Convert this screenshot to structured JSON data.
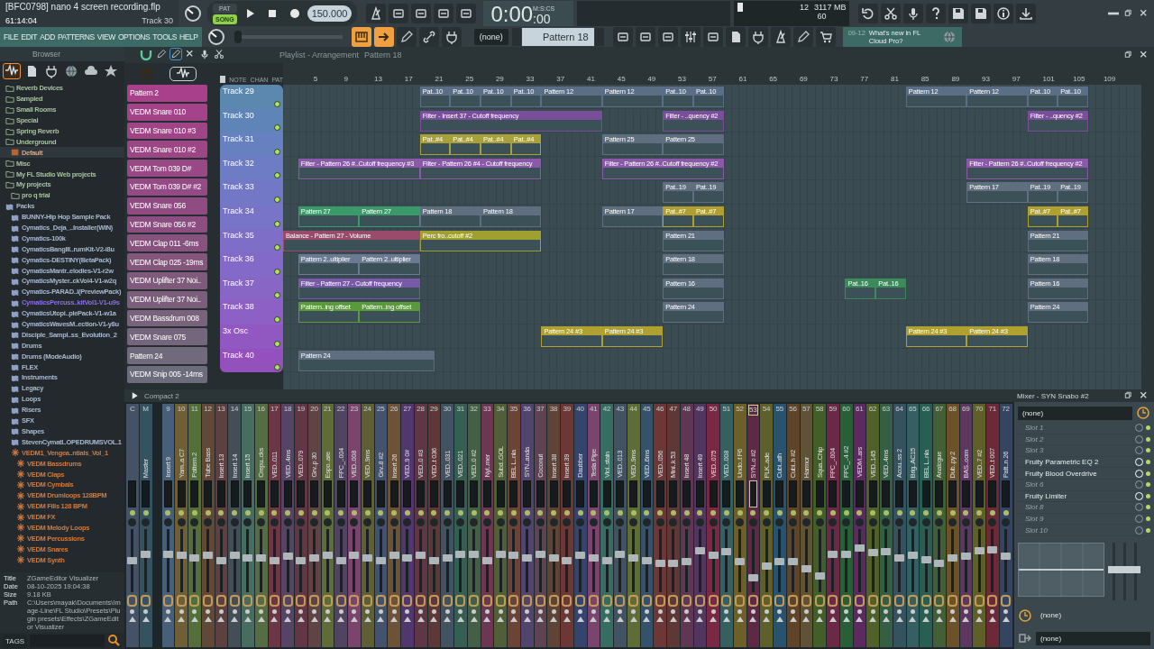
{
  "title_panel": {
    "project": "[BFC0798] nano 4 screen recording.flp",
    "position": "61:14:04",
    "track": "Track 30"
  },
  "transport": {
    "pat": "PAT",
    "song": "SONG",
    "song_mode": true,
    "tempo": "150.000",
    "time": "0:00",
    "time_cs": ":00",
    "time_unit": "M:S:CS"
  },
  "monitor": {
    "cpu": "12",
    "memory": "3117 MB",
    "polyphony": "60"
  },
  "menu": [
    "FILE",
    "EDIT",
    "ADD",
    "PATTERNS",
    "VIEW",
    "OPTIONS",
    "TOOLS",
    "HELP"
  ],
  "master_pitch": {
    "level": 0
  },
  "snap": "(none)",
  "pattern": "Pattern 18",
  "news": {
    "date": "09-12",
    "text": "What's new in FL Cloud Pro?"
  },
  "browser": {
    "title": "Browser",
    "tree": [
      {
        "label": "Reverb Devices",
        "kind": "folder",
        "selected": false
      },
      {
        "label": "Sampled",
        "kind": "folder",
        "selected": false
      },
      {
        "label": "Small Rooms",
        "kind": "folder",
        "selected": false
      },
      {
        "label": "Special",
        "kind": "folder",
        "selected": false
      },
      {
        "label": "Spring Reverb",
        "kind": "folder",
        "selected": false
      },
      {
        "label": "Underground",
        "kind": "folder",
        "selected": false,
        "children": [
          {
            "label": "Default",
            "kind": "preset",
            "selected": false
          }
        ]
      },
      {
        "label": "Misc",
        "kind": "folder",
        "selected": false
      },
      {
        "label": "My FL Studio Web projects",
        "kind": "folder",
        "selected": false
      },
      {
        "label": "My projects",
        "kind": "folder",
        "selected": false,
        "children": [
          {
            "label": "pro q trial",
            "kind": "folder",
            "selected": false
          }
        ]
      },
      {
        "label": "Packs",
        "kind": "pack",
        "selected": false,
        "children": [
          {
            "label": "BUNNY-Hip Hop Sample Pack",
            "kind": "pack",
            "selected": false
          },
          {
            "label": "Cymatics_Deja_..Installer(WIN)",
            "kind": "pack",
            "selected": false
          },
          {
            "label": "Cymatics-100k",
            "kind": "pack",
            "selected": false
          },
          {
            "label": "CymaticsBangIII..rumKit-V2-i8u",
            "kind": "pack",
            "selected": false
          },
          {
            "label": "Cymatics-DESTINY(BetaPack)",
            "kind": "pack",
            "selected": false
          },
          {
            "label": "CymaticsMantr..elodies-V1-r2w",
            "kind": "pack",
            "selected": false
          },
          {
            "label": "CymaticsMyster..ckVol4-V1-w2q",
            "kind": "pack",
            "selected": false
          },
          {
            "label": "Cymatics-PARAD..I(PreviewPack)",
            "kind": "pack",
            "selected": false
          },
          {
            "label": "CymaticsPercuss..kitVol1-V1-u9s",
            "kind": "pack",
            "selected": true
          },
          {
            "label": "CymaticsUtopi..plePack-V1-w1a",
            "kind": "pack",
            "selected": false
          },
          {
            "label": "CymaticsWavesM..ection-V1-y8u",
            "kind": "pack",
            "selected": false
          },
          {
            "label": "Disciple_Sampl..ss_Evolution_2",
            "kind": "pack",
            "selected": false
          },
          {
            "label": "Drums",
            "kind": "pack",
            "selected": false
          },
          {
            "label": "Drums (ModeAudio)",
            "kind": "pack",
            "selected": false
          },
          {
            "label": "FLEX",
            "kind": "pack",
            "selected": false
          },
          {
            "label": "Instruments",
            "kind": "pack",
            "selected": false
          },
          {
            "label": "Legacy",
            "kind": "pack",
            "selected": false
          },
          {
            "label": "Loops",
            "kind": "pack",
            "selected": false
          },
          {
            "label": "Risers",
            "kind": "pack",
            "selected": false
          },
          {
            "label": "SFX",
            "kind": "pack",
            "selected": false
          },
          {
            "label": "Shapes",
            "kind": "pack",
            "selected": false
          },
          {
            "label": "StevenCymatI..OPEDRUMSVOL.1",
            "kind": "pack",
            "selected": false
          },
          {
            "label": "VEDM1_Vengea..ntials_Vol_1",
            "kind": "kit",
            "selected": false,
            "children": [
              {
                "label": "VEDM Bassdrums",
                "kind": "kit",
                "selected": false
              },
              {
                "label": "VEDM Claps",
                "kind": "kit",
                "selected": false
              },
              {
                "label": "VEDM Cymbals",
                "kind": "kit",
                "selected": false
              },
              {
                "label": "VEDM Drumloops 128BPM",
                "kind": "kit",
                "selected": false
              },
              {
                "label": "VEDM Fills 128 BPM",
                "kind": "kit",
                "selected": false
              },
              {
                "label": "VEDM FX",
                "kind": "kit",
                "selected": false
              },
              {
                "label": "VEDM Melody Loops",
                "kind": "kit",
                "selected": false
              },
              {
                "label": "VEDM Percussions",
                "kind": "kit",
                "selected": false
              },
              {
                "label": "VEDM Snares",
                "kind": "kit",
                "selected": false
              },
              {
                "label": "VEDM Synth",
                "kind": "kit",
                "selected": false
              }
            ]
          }
        ]
      }
    ],
    "info": [
      {
        "key": "Title",
        "value": "ZGameEditor Visualizer"
      },
      {
        "key": "Date",
        "value": "08-10-2025 19:04:38"
      },
      {
        "key": "Size",
        "value": "9.18 KB"
      },
      {
        "key": "Path",
        "value": "C:\\Users\\mayak\\Documents\\Image-Line\\FL Studio\\Presets\\Plugin presets\\Effects\\ZGameEditor Visualizer"
      }
    ],
    "tags": "TAGS"
  },
  "playlist": {
    "title": "Playlist - Arrangement",
    "pattern": "Pattern 18",
    "view_buttons": [
      "NOTE",
      "CHAN",
      "PAT"
    ],
    "ruler": [
      "5",
      "9",
      "13",
      "17",
      "21",
      "25",
      "29",
      "33",
      "37",
      "41",
      "45",
      "49",
      "53",
      "57",
      "61",
      "65",
      "69",
      "73",
      "77",
      "81",
      "85",
      "89",
      "93",
      "97",
      "101",
      "105",
      "109"
    ],
    "channels": [
      {
        "name": "Pattern 2",
        "color": "#a8408c"
      },
      {
        "name": "VEDM Snare 010",
        "color": "#a4428a"
      },
      {
        "name": "VEDM Snare 010 #3",
        "color": "#a04488"
      },
      {
        "name": "VEDM Snare 010 #2",
        "color": "#9c4686"
      },
      {
        "name": "VEDM Tom 039 D#",
        "color": "#984884"
      },
      {
        "name": "VEDM Tom 039 D# #2",
        "color": "#944a84"
      },
      {
        "name": "VEDM Snare 056",
        "color": "#904c82"
      },
      {
        "name": "VEDM Snare 056 #2",
        "color": "#8c4e80"
      },
      {
        "name": "VEDM Clap 011 -6ms",
        "color": "#88527e"
      },
      {
        "name": "VEDM Clap 025 -19ms",
        "color": "#84567c"
      },
      {
        "name": "VEDM Uplifter 37 Noi..",
        "color": "#805a7c"
      },
      {
        "name": "VEDM Uplifter 37 Noi..",
        "color": "#7c5e7c"
      },
      {
        "name": "VEDM Bassdrum 008",
        "color": "#78627c"
      },
      {
        "name": "VEDM Snare 075",
        "color": "#74667c"
      },
      {
        "name": "Pattern 24",
        "color": "#706a7c"
      },
      {
        "name": "VEDM Snip 005 -14ms",
        "color": "#6c6c7c"
      }
    ],
    "tracks": [
      {
        "name": "Track 29",
        "color": "#5c88b0",
        "clips": [
          {
            "label": "Pat..10",
            "color": "#5a6f86"
          },
          {
            "label": "Pat..10",
            "color": "#5a6f86"
          },
          {
            "label": "Pat..10",
            "color": "#5a6f86"
          },
          {
            "label": "Pat..10",
            "color": "#5a6f86"
          },
          {
            "label": "Pattern 12",
            "color": "#5a6f86"
          },
          {
            "label": "Pattern 12",
            "color": "#5a6f86"
          },
          {
            "label": "Pat..10",
            "color": "#5a6f86"
          },
          {
            "label": "Pat..10",
            "color": "#5a6f86"
          },
          {
            "label": "Pattern 12",
            "color": "#5a6f86"
          },
          {
            "label": "Pattern 12",
            "color": "#5a6f86"
          },
          {
            "label": "Pat..10",
            "color": "#5a6f86"
          },
          {
            "label": "Pat..10",
            "color": "#5a6f86"
          }
        ]
      },
      {
        "name": "Track 30",
        "color": "#5f85b8",
        "clips": [
          {
            "label": "Filter - Insert 37 - Cutoff frequency",
            "color": "#7a4f9a"
          },
          {
            "label": "Filter - ..quency #2",
            "color": "#7a4f9a"
          },
          {
            "label": "Filter - ..quency #2",
            "color": "#7a4f9a"
          }
        ]
      },
      {
        "name": "Track 31",
        "color": "#6680c0",
        "clips": [
          {
            "label": "Pat..#4",
            "color": "#a8a03a"
          },
          {
            "label": "Pat..#4",
            "color": "#a8a03a"
          },
          {
            "label": "Pat..#4",
            "color": "#a8a03a"
          },
          {
            "label": "Pat..#4",
            "color": "#a8a03a"
          },
          {
            "label": "Pattern 25",
            "color": "#5f6f80"
          },
          {
            "label": "Pattern 25",
            "color": "#5f6f80"
          }
        ]
      },
      {
        "name": "Track 32",
        "color": "#6d7cc4",
        "clips": [
          {
            "label": "Filter - Pattern 26 #..Cutoff frequency #3",
            "color": "#8a5aa8"
          },
          {
            "label": "Filter - Pattern 26 #4 - Cutoff frequency",
            "color": "#8a5aa8"
          },
          {
            "label": "Filter - Pattern 26 #..Cutoff frequency #2",
            "color": "#8a5aa8"
          },
          {
            "label": "Filter - Pattern 26 #..Cutoff frequency #2",
            "color": "#8a5aa8"
          }
        ]
      },
      {
        "name": "Track 33",
        "color": "#7278c6",
        "clips": [
          {
            "label": "Pat..19",
            "color": "#5f6f80"
          },
          {
            "label": "Pat..19",
            "color": "#5f6f80"
          },
          {
            "label": "Pattern 17",
            "color": "#5f6f80"
          },
          {
            "label": "Pat..19",
            "color": "#5f6f80"
          },
          {
            "label": "Pat..19",
            "color": "#5f6f80"
          }
        ]
      },
      {
        "name": "Track 34",
        "color": "#7874c8",
        "clips": [
          {
            "label": "Pattern 27",
            "color": "#3a9a6a"
          },
          {
            "label": "Pattern 27",
            "color": "#3a9a6a"
          },
          {
            "label": "Pattern 18",
            "color": "#5f6f80"
          },
          {
            "label": "Pattern 18",
            "color": "#5f6f80"
          },
          {
            "label": "Pattern 17",
            "color": "#5f6f80"
          },
          {
            "label": "Pat..#7",
            "color": "#b0a030"
          },
          {
            "label": "Pat..#7",
            "color": "#b0a030"
          },
          {
            "label": "Pat..#7",
            "color": "#b0a030"
          },
          {
            "label": "Pat..#7",
            "color": "#b0a030"
          }
        ]
      },
      {
        "name": "Track 35",
        "color": "#7e6ec8",
        "clips": [
          {
            "label": "Balance - Pattern 27 - Volume",
            "color": "#9a4a6a"
          },
          {
            "label": "Perc fro..cutoff #2",
            "color": "#a0a030"
          },
          {
            "label": "Pattern 21",
            "color": "#5f6f80"
          },
          {
            "label": "Pattern 21",
            "color": "#5f6f80"
          }
        ]
      },
      {
        "name": "Track 36",
        "color": "#836ac8",
        "clips": [
          {
            "label": "Pattern 2..ultiplier",
            "color": "#6a7a90"
          },
          {
            "label": "Pattern 2..ultiplier",
            "color": "#6a7a90"
          },
          {
            "label": "Pattern 18",
            "color": "#5f6f80"
          },
          {
            "label": "Pattern 18",
            "color": "#5f6f80"
          }
        ]
      },
      {
        "name": "Track 37",
        "color": "#8866c6",
        "clips": [
          {
            "label": "Filter - Pattern 27 - Cutoff frequency",
            "color": "#7a5aa8"
          },
          {
            "label": "Pattern 16",
            "color": "#5f6f80"
          },
          {
            "label": "Pat..16",
            "color": "#3a8a5a"
          },
          {
            "label": "Pat..16",
            "color": "#3a8a5a"
          },
          {
            "label": "Pattern 16",
            "color": "#5f6f80"
          }
        ]
      },
      {
        "name": "Track 38",
        "color": "#8c60c4",
        "clips": [
          {
            "label": "Pattern..ing offset",
            "color": "#5a9a3a"
          },
          {
            "label": "Pattern..ing offset",
            "color": "#5a9a3a"
          },
          {
            "label": "Pattern 24",
            "color": "#5f6f80"
          },
          {
            "label": "Pattern 24",
            "color": "#5f6f80"
          }
        ]
      },
      {
        "name": "3x Osc",
        "color": "#9058c0",
        "clips": [
          {
            "label": "Pattern 24 #3",
            "color": "#b0a030"
          },
          {
            "label": "Pattern 24 #3",
            "color": "#b0a030"
          },
          {
            "label": "Pattern 24 #3",
            "color": "#b0a030"
          },
          {
            "label": "Pattern 24 #3",
            "color": "#b0a030"
          }
        ]
      },
      {
        "name": "Track 40",
        "color": "#9450bc",
        "clips": [
          {
            "label": "Pattern 24",
            "color": "#5f6f80"
          }
        ]
      }
    ]
  },
  "mixer": {
    "preset": "Compact 2",
    "title": "Mixer - SYN Snabo #2",
    "strips": [
      {
        "number": "C",
        "color": "#4a5a70",
        "level": 0.5,
        "selected": false
      },
      {
        "number": "M",
        "label": "Master",
        "color": "#3a5a6a",
        "level": 0.62,
        "selected": false
      },
      {
        "number": "9",
        "label": "Insert 9",
        "color": "#4f6a86",
        "level": 0.62,
        "selected": false
      },
      {
        "number": "10",
        "label": "Yam..a C7",
        "color": "#7d6a3a",
        "level": 0.6,
        "selected": false
      },
      {
        "number": "11",
        "label": "Pattern 2",
        "color": "#5d7a3f",
        "level": 0.55,
        "selected": false
      },
      {
        "number": "12",
        "label": "Tube Bass",
        "color": "#6d4f3a",
        "level": 0.6,
        "selected": false
      },
      {
        "number": "13",
        "label": "Insert 13",
        "color": "#6b4545",
        "level": 0.5,
        "selected": false
      },
      {
        "number": "14",
        "label": "Insert 14",
        "color": "#4a5560",
        "level": 0.6,
        "selected": false
      },
      {
        "number": "15",
        "label": "Insert 15",
        "color": "#4d7a6a",
        "level": 0.55,
        "selected": false
      },
      {
        "number": "16",
        "label": "Crepu..cks",
        "color": "#5f7a4a",
        "level": 0.55,
        "selected": false
      },
      {
        "number": "17",
        "label": "VED..011",
        "color": "#7a3a4a",
        "level": 0.5,
        "selected": false
      },
      {
        "number": "18",
        "label": "VED..4ms",
        "color": "#5f4a6e",
        "level": 0.58,
        "selected": false
      },
      {
        "number": "19",
        "label": "VED..079",
        "color": "#6d3a4a",
        "level": 0.5,
        "selected": false
      },
      {
        "number": "20",
        "label": "Grv..p 30",
        "color": "#6a4a4a",
        "level": 0.55,
        "selected": false
      },
      {
        "number": "21",
        "label": "Espo..are",
        "color": "#6a7a3a",
        "level": 0.6,
        "selected": false
      },
      {
        "number": "22",
        "label": "FPC_..004",
        "color": "#5a4a6a",
        "level": 0.5,
        "selected": false
      },
      {
        "number": "23",
        "label": "VED..008",
        "color": "#8a4a7a",
        "level": 0.6,
        "selected": false
      },
      {
        "number": "24",
        "label": "VED..9ms",
        "color": "#6a6a3a",
        "level": 0.55,
        "selected": false
      },
      {
        "number": "25",
        "label": "Grv..8 #2",
        "color": "#4a5a7a",
        "level": 0.5,
        "selected": false
      },
      {
        "number": "26",
        "label": "Insert 26",
        "color": "#7a5a3a",
        "level": 0.6,
        "selected": false
      },
      {
        "number": "27",
        "label": "VED..9 0#",
        "color": "#5a3a7a",
        "level": 0.55,
        "selected": false
      },
      {
        "number": "28",
        "label": "VED..0 #3",
        "color": "#6a3a4a",
        "level": 0.6,
        "selected": false
      },
      {
        "number": "29",
        "label": "VED..t 036",
        "color": "#6a3a3a",
        "level": 0.5,
        "selected": false
      },
      {
        "number": "30",
        "label": "VED..031",
        "color": "#4a5a6a",
        "level": 0.55,
        "selected": false
      },
      {
        "number": "31",
        "label": "VED..021",
        "color": "#3a6a5a",
        "level": 0.62,
        "selected": false
      },
      {
        "number": "32",
        "label": "VED..0 #2",
        "color": "#4a6a4a",
        "level": 0.62,
        "selected": false
      },
      {
        "number": "33",
        "label": "Nyl..mer",
        "color": "#7a3a5a",
        "level": 0.5,
        "selected": false
      },
      {
        "number": "34",
        "label": "Subd..GOL",
        "color": "#5a6a3a",
        "level": 0.62,
        "selected": false
      },
      {
        "number": "35",
        "label": "BEL L..nla",
        "color": "#7a4a3a",
        "level": 0.6,
        "selected": false
      },
      {
        "number": "36",
        "label": "SYN..anda",
        "color": "#5a4a7a",
        "level": 0.55,
        "selected": false
      },
      {
        "number": "37",
        "label": "Coconut",
        "color": "#6a4a5a",
        "level": 0.62,
        "selected": false
      },
      {
        "number": "38",
        "label": "Insert 38",
        "color": "#6a4a3a",
        "level": 0.55,
        "selected": false
      },
      {
        "number": "39",
        "label": "Insert 39",
        "color": "#7a3a3a",
        "level": 0.5,
        "selected": false
      },
      {
        "number": "40",
        "label": "Daubber",
        "color": "#3a4a7a",
        "level": 0.6,
        "selected": false
      },
      {
        "number": "41",
        "label": "Tesla Pipe",
        "color": "#8a4a7a",
        "level": 0.55,
        "selected": false
      },
      {
        "number": "42",
        "label": "Viol..stain",
        "color": "#3a7a6a",
        "level": 0.5,
        "selected": false
      },
      {
        "number": "43",
        "label": "VED..013",
        "color": "#4a5a6a",
        "level": 0.62,
        "selected": false
      },
      {
        "number": "44",
        "label": "VED..9ms",
        "color": "#6a7a3a",
        "level": 0.55,
        "selected": false
      },
      {
        "number": "45",
        "label": "VED..6ms",
        "color": "#3a5a7a",
        "level": 0.5,
        "selected": false
      },
      {
        "number": "46",
        "label": "VED..056",
        "color": "#7a3a3a",
        "level": 0.45,
        "selected": false
      },
      {
        "number": "47",
        "label": "Mini..k 53",
        "color": "#6a3a3a",
        "level": 0.45,
        "selected": false
      },
      {
        "number": "48",
        "label": "Insert 48",
        "color": "#6a3a5a",
        "level": 0.48,
        "selected": false
      },
      {
        "number": "49",
        "label": "Insert 49",
        "color": "#5a3a6a",
        "level": 0.68,
        "selected": false
      },
      {
        "number": "50",
        "label": "VED..075",
        "color": "#8a2a4a",
        "level": 0.6,
        "selected": false
      },
      {
        "number": "51",
        "label": "VED..008",
        "color": "#3a6a6a",
        "level": 0.66,
        "selected": false
      },
      {
        "number": "52",
        "label": "Undo..t F6",
        "color": "#7a6a2a",
        "level": 0.48,
        "selected": false
      },
      {
        "number": "53",
        "label": "SYN..o #2",
        "color": "#6a2a4a",
        "level": 0.2,
        "selected": true
      },
      {
        "number": "54",
        "label": "PLK..ade",
        "color": "#6a6a2a",
        "level": 0.4,
        "selected": false
      },
      {
        "number": "55",
        "label": "Cubi..ath",
        "color": "#2a5a7a",
        "level": 0.48,
        "selected": false
      },
      {
        "number": "56",
        "label": "Cubi..h #2",
        "color": "#6a4a2a",
        "level": 0.48,
        "selected": false
      },
      {
        "number": "57",
        "label": "Harmor",
        "color": "#6a5a3a",
        "level": 0.35,
        "selected": false
      },
      {
        "number": "58",
        "label": "Squa..Chip",
        "color": "#4a6a2a",
        "level": 0.22,
        "selected": false
      },
      {
        "number": "59",
        "label": "FPC_..004",
        "color": "#7a2a4a",
        "level": 0.62,
        "selected": false
      },
      {
        "number": "60",
        "label": "FPC_..4 #2",
        "color": "#2a6a3a",
        "level": 0.62,
        "selected": false
      },
      {
        "number": "61",
        "label": "VEDM..ars",
        "color": "#6a2a6a",
        "level": 0.72,
        "selected": false
      },
      {
        "number": "62",
        "label": "VED..145",
        "color": "#5a6a2a",
        "level": 0.64,
        "selected": false
      },
      {
        "number": "63",
        "label": "VED..4ms",
        "color": "#3a6a4a",
        "level": 0.66,
        "selected": false
      },
      {
        "number": "64",
        "label": "Acou..ss 2",
        "color": "#3a5a6a",
        "level": 0.55,
        "selected": false
      },
      {
        "number": "65",
        "label": "Brig..AC15",
        "color": "#3a6a6a",
        "level": 0.6,
        "selected": false
      },
      {
        "number": "66",
        "label": "BEL L..nla",
        "color": "#2a6a5a",
        "level": 0.52,
        "selected": false
      },
      {
        "number": "67",
        "label": "Analogue",
        "color": "#4a6a3a",
        "level": 0.45,
        "selected": false
      },
      {
        "number": "68",
        "label": "Dub..py 2",
        "color": "#7a5a2a",
        "level": 0.55,
        "selected": false
      },
      {
        "number": "69",
        "label": "BAS..oom",
        "color": "#6a3a6a",
        "level": 0.58,
        "selected": false
      },
      {
        "number": "70",
        "label": "VED..7 #2",
        "color": "#6a6a2a",
        "level": 0.68,
        "selected": false
      },
      {
        "number": "71",
        "label": "VED..t 007",
        "color": "#7a2a3a",
        "level": 0.7,
        "selected": false
      },
      {
        "number": "72",
        "label": "Patt..n 26",
        "color": "#3a4a6a",
        "level": 0.58,
        "selected": false
      }
    ],
    "insert_preset": "(none)",
    "slots": [
      {
        "label": "Slot 1",
        "kind": "empty"
      },
      {
        "label": "Slot 2",
        "kind": "empty"
      },
      {
        "label": "Slot 3",
        "kind": "empty"
      },
      {
        "label": "Fruity Parametric EQ 2",
        "kind": "plugin"
      },
      {
        "label": "Fruity Blood Overdrive",
        "kind": "plugin"
      },
      {
        "label": "Slot 6",
        "kind": "empty"
      },
      {
        "label": "Fruity Limiter",
        "kind": "plugin"
      },
      {
        "label": "Slot 8",
        "kind": "empty"
      },
      {
        "label": "Slot 9",
        "kind": "empty"
      },
      {
        "label": "Slot 10",
        "kind": "empty"
      }
    ],
    "input": "(none)",
    "output": "(none)"
  }
}
